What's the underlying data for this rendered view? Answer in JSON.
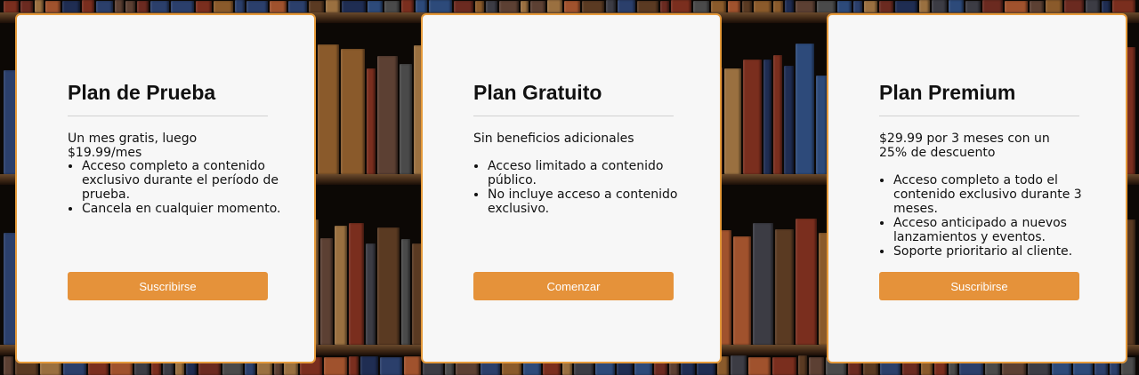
{
  "plans": [
    {
      "title": "Plan de Prueba",
      "description": "Un mes gratis, luego $19.99/mes",
      "features": [
        "Acceso completo a contenido exclusivo durante el período de prueba.",
        "Cancela en cualquier momento."
      ],
      "button": "Suscribirse"
    },
    {
      "title": "Plan Gratuito",
      "description": "Sin beneficios adicionales",
      "features": [
        "Acceso limitado a contenido público.",
        "No incluye acceso a contenido exclusivo."
      ],
      "button": "Comenzar"
    },
    {
      "title": "Plan Premium",
      "description": "$29.99 por 3 meses con un 25% de descuento",
      "features": [
        "Acceso completo a todo el contenido exclusivo durante 3 meses.",
        "Acceso anticipado a nuevos lanzamientos y eventos.",
        "Soporte prioritario al cliente."
      ],
      "button": "Suscribirse"
    }
  ],
  "colors": {
    "accent": "#e5923a",
    "card_border": "#e59a3b",
    "card_bg": "#f7f7f7"
  }
}
